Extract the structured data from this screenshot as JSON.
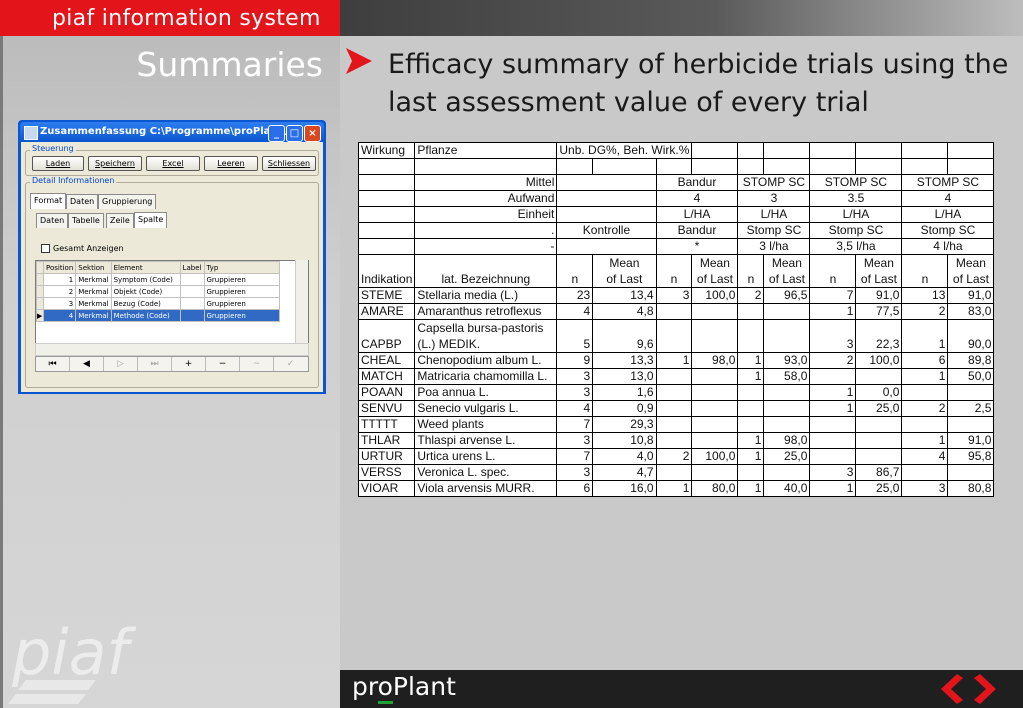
{
  "header": {
    "title": "piaf information system"
  },
  "section_title": "Summaries",
  "heading": "Efficacy summary of herbicide trials using the last assessment value of every trial",
  "brand": {
    "proplant_pre": "pr",
    "proplant_o": "o",
    "proplant_post": "Plant",
    "piaf_logo": "piaf"
  },
  "colors": {
    "red": "#e4141b",
    "green": "#1fa339"
  },
  "dialog": {
    "title": "Zusammenfassung C:\\Programme\\proPlant\\...",
    "steuerung_label": "Steuerung",
    "buttons": [
      "Laden",
      "Speichern",
      "Excel",
      "Leeren",
      "Schliessen"
    ],
    "detail_label": "Detail Informationen",
    "tabs_top": [
      "Format",
      "Daten",
      "Gruppierung"
    ],
    "tabs_sub": [
      "Daten",
      "Tabelle",
      "Zeile",
      "Spalte"
    ],
    "checkbox_label": "Gesamt Anzeigen",
    "grid_headers": [
      "Position",
      "Sektion",
      "Element",
      "Label",
      "Typ"
    ],
    "grid_rows": [
      [
        "1",
        "Merkmal",
        "Symptom (Code)",
        "",
        "Gruppieren"
      ],
      [
        "2",
        "Merkmal",
        "Objekt (Code)",
        "",
        "Gruppieren"
      ],
      [
        "3",
        "Merkmal",
        "Bezug (Code)",
        "",
        "Gruppieren"
      ],
      [
        "4",
        "Merkmal",
        "Methode (Code)",
        "",
        "Gruppieren"
      ]
    ]
  },
  "table": {
    "rows_header": [
      [
        "Wirkung",
        "Pflanze",
        "Unb. DG%, Beh. Wirk.%",
        "",
        "",
        "",
        "",
        "",
        "",
        "",
        ""
      ],
      [
        "",
        "",
        "",
        "",
        "",
        "",
        "",
        "",
        "",
        "",
        ""
      ]
    ],
    "mittel": {
      "label": "Mittel",
      "groups": [
        "",
        "Bandur",
        "STOMP SC",
        "STOMP SC",
        "STOMP SC"
      ]
    },
    "aufwand": {
      "label": "Aufwand",
      "groups": [
        "",
        "4",
        "3",
        "3.5",
        "4"
      ]
    },
    "einheit": {
      "label": "Einheit",
      "groups": [
        "",
        "L/HA",
        "L/HA",
        "L/HA",
        "L/HA"
      ]
    },
    "dot_row": {
      "label": ".",
      "groups": [
        "Kontrolle",
        "Bandur",
        "Stomp SC",
        "Stomp SC",
        "Stomp SC"
      ]
    },
    "dash_row": {
      "label": "-",
      "groups": [
        "",
        "*",
        "3 l/ha",
        "3,5 l/ha",
        "4 l/ha"
      ]
    },
    "col_headers": {
      "indikation": "Indikation",
      "bezeichnung": "lat. Bezeichnung",
      "n": "n",
      "mean_top": "Mean",
      "mean_bottom": "of Last"
    },
    "rows": [
      [
        "STEME",
        "Stellaria media (L.)",
        "23",
        "13,4",
        "3",
        "100,0",
        "2",
        "96,5",
        "7",
        "91,0",
        "13",
        "91,0"
      ],
      [
        "AMARE",
        "Amaranthus retroflexus",
        "4",
        "4,8",
        "",
        "",
        "",
        "",
        "1",
        "77,5",
        "2",
        "83,0"
      ],
      [
        "CAPBP",
        "Capsella bursa-pastoris (L.) MEDIK.",
        "5",
        "9,6",
        "",
        "",
        "",
        "",
        "3",
        "22,3",
        "1",
        "90,0"
      ],
      [
        "CHEAL",
        "Chenopodium album L.",
        "9",
        "13,3",
        "1",
        "98,0",
        "1",
        "93,0",
        "2",
        "100,0",
        "6",
        "89,8"
      ],
      [
        "MATCH",
        "Matricaria chamomilla L.",
        "3",
        "13,0",
        "",
        "",
        "1",
        "58,0",
        "",
        "",
        "1",
        "50,0"
      ],
      [
        "POAAN",
        "Poa annua L.",
        "3",
        "1,6",
        "",
        "",
        "",
        "",
        "1",
        "0,0",
        "",
        ""
      ],
      [
        "SENVU",
        "Senecio vulgaris L.",
        "4",
        "0,9",
        "",
        "",
        "",
        "",
        "1",
        "25,0",
        "2",
        "2,5"
      ],
      [
        "TTTTT",
        "Weed plants",
        "7",
        "29,3",
        "",
        "",
        "",
        "",
        "",
        "",
        "",
        ""
      ],
      [
        "THLAR",
        "Thlaspi arvense L.",
        "3",
        "10,8",
        "",
        "",
        "1",
        "98,0",
        "",
        "",
        "1",
        "91,0"
      ],
      [
        "URTUR",
        "Urtica urens L.",
        "7",
        "4,0",
        "2",
        "100,0",
        "1",
        "25,0",
        "",
        "",
        "4",
        "95,8"
      ],
      [
        "VERSS",
        "Veronica L. spec.",
        "3",
        "4,7",
        "",
        "",
        "",
        "",
        "3",
        "86,7",
        "",
        ""
      ],
      [
        "VIOAR",
        "Viola arvensis MURR.",
        "6",
        "16,0",
        "1",
        "80,0",
        "1",
        "40,0",
        "1",
        "25,0",
        "3",
        "80,8"
      ]
    ]
  }
}
